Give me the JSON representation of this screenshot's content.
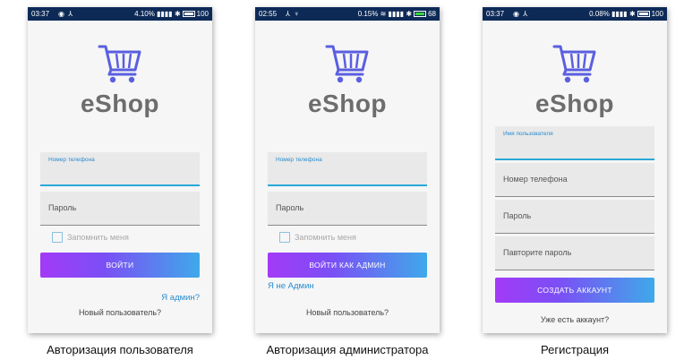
{
  "brand_name": "eShop",
  "screens": [
    {
      "status": {
        "time": "03:37",
        "right": "4.10%",
        "battery": "100"
      },
      "fields": [
        {
          "label": "Номер телефона",
          "value": ""
        },
        {
          "placeholder": "Пароль"
        }
      ],
      "checkbox_label": "Запомнить меня",
      "button_label": "ВОЙТИ",
      "link_label": "Я админ?",
      "bottom_link": "Новый пользователь?",
      "caption": "Авторизация пользователя"
    },
    {
      "status": {
        "time": "02:55",
        "right": "0.15%",
        "battery": "68"
      },
      "fields": [
        {
          "label": "Номер телефона",
          "value": ""
        },
        {
          "placeholder": "Пароль"
        }
      ],
      "checkbox_label": "Запомнить меня",
      "button_label": "ВОЙТИ КАК АДМИН",
      "link_label": "Я не Админ",
      "bottom_link": "Новый пользователь?",
      "caption": "Авторизация администратора"
    },
    {
      "status": {
        "time": "03:37",
        "right": "0.08%",
        "battery": "100"
      },
      "fields": [
        {
          "label": "Имя пользователя",
          "value": ""
        },
        {
          "placeholder": "Номер телефона"
        },
        {
          "placeholder": "Пароль"
        },
        {
          "placeholder": "Павторите пароль"
        }
      ],
      "button_label": "СОЗДАТЬ АККАУНТ",
      "bottom_link": "Уже есть аккаунт?",
      "caption": "Регистрация"
    }
  ],
  "colors": {
    "accent_blue": "#2a8ccf",
    "gradient_start": "#a33af7",
    "gradient_end": "#3fa9ea",
    "statusbar": "#0d2a57",
    "cart": "#5a5fe0"
  },
  "icons": [
    "cart-icon",
    "checkbox-icon",
    "battery-icon",
    "signal-icon",
    "wifi-icon"
  ]
}
